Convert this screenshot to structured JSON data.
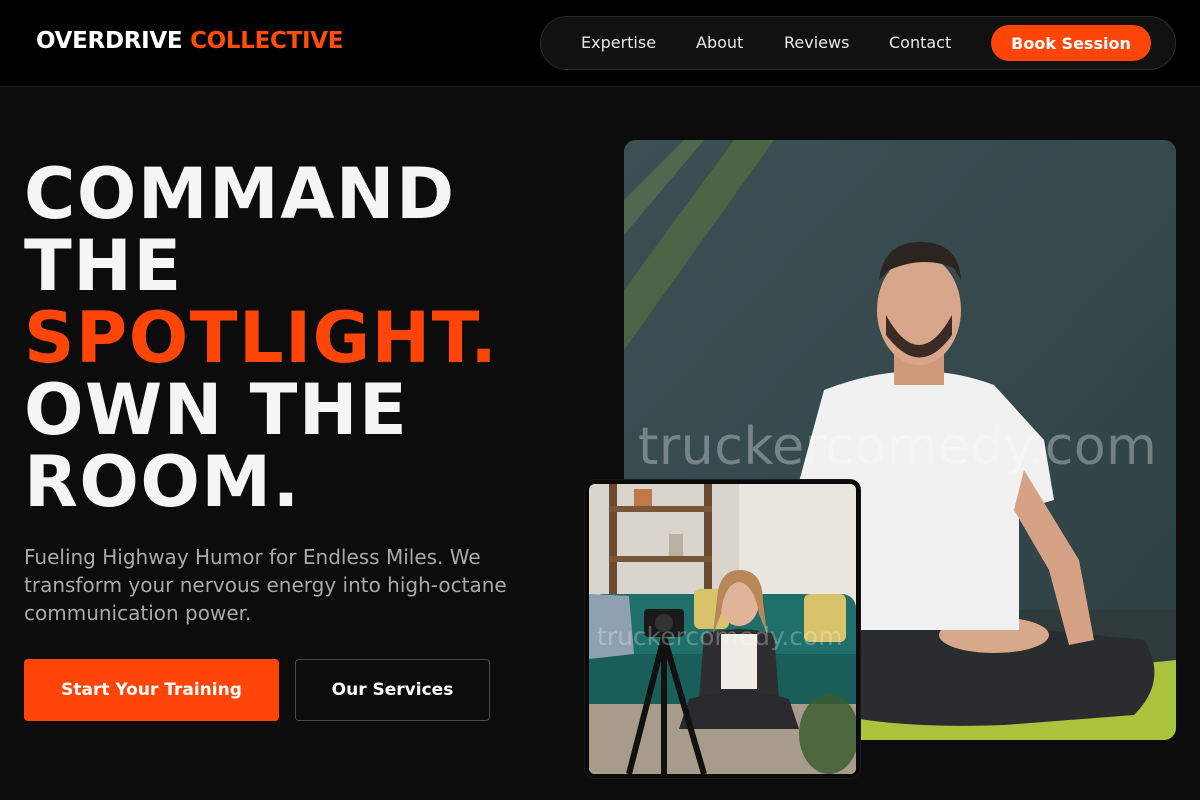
{
  "brand": {
    "name_part1": "OVERDRIVE",
    "name_part2": "COLLECTIVE",
    "accent_color": "#ff4508"
  },
  "nav": {
    "items": [
      {
        "label": "Expertise"
      },
      {
        "label": "About"
      },
      {
        "label": "Reviews"
      },
      {
        "label": "Contact"
      }
    ],
    "cta_label": "Book Session"
  },
  "hero": {
    "headline_lines": [
      "COMMAND",
      "THE",
      "SPOTLIGHT.",
      "OWN THE",
      "ROOM."
    ],
    "subtitle": "Fueling Highway Humor for Endless Miles. We transform your nervous energy into high-octane communication power.",
    "primary_button": "Start Your Training",
    "secondary_button": "Our Services"
  },
  "media": {
    "main_photo_watermark": "truckercomedy.com",
    "inset_photo_watermark": "truckercomedy.com"
  }
}
